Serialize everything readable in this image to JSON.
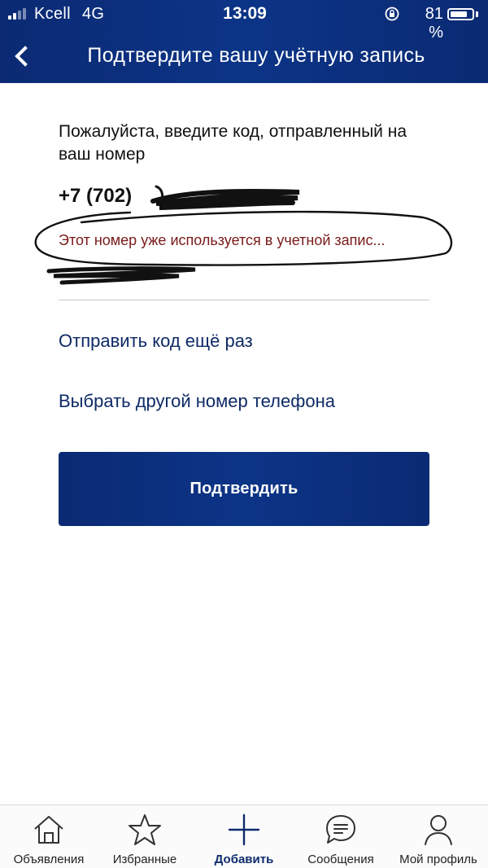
{
  "status_bar": {
    "carrier": "Kcell",
    "network": "4G",
    "time": "13:09",
    "battery_percent": "81 %",
    "battery_level": 0.81
  },
  "header": {
    "title": "Подтвердите вашу учётную запись",
    "back_icon": "chevron-left-icon",
    "background_color": "#0c3487"
  },
  "verification": {
    "instruction": "Пожалуйста, введите код, отправленный на ваш номер",
    "phone_visible_part": "+7 (702)",
    "error_message": "Этот номер уже используется в учетной запис...",
    "resend_link": "Отправить код ещё раз",
    "change_number_link": "Выбрать другой номер телефона",
    "confirm_button": "Подтвердить"
  },
  "tabbar": {
    "active_color": "#0d2b6c",
    "items": [
      {
        "label": "Объявления",
        "icon": "home-icon",
        "active": false
      },
      {
        "label": "Избранные",
        "icon": "star-icon",
        "active": false
      },
      {
        "label": "Добавить",
        "icon": "plus-icon",
        "active": true
      },
      {
        "label": "Сообщения",
        "icon": "chat-icon",
        "active": false
      },
      {
        "label": "Мой профиль",
        "icon": "user-icon",
        "active": false
      }
    ]
  }
}
